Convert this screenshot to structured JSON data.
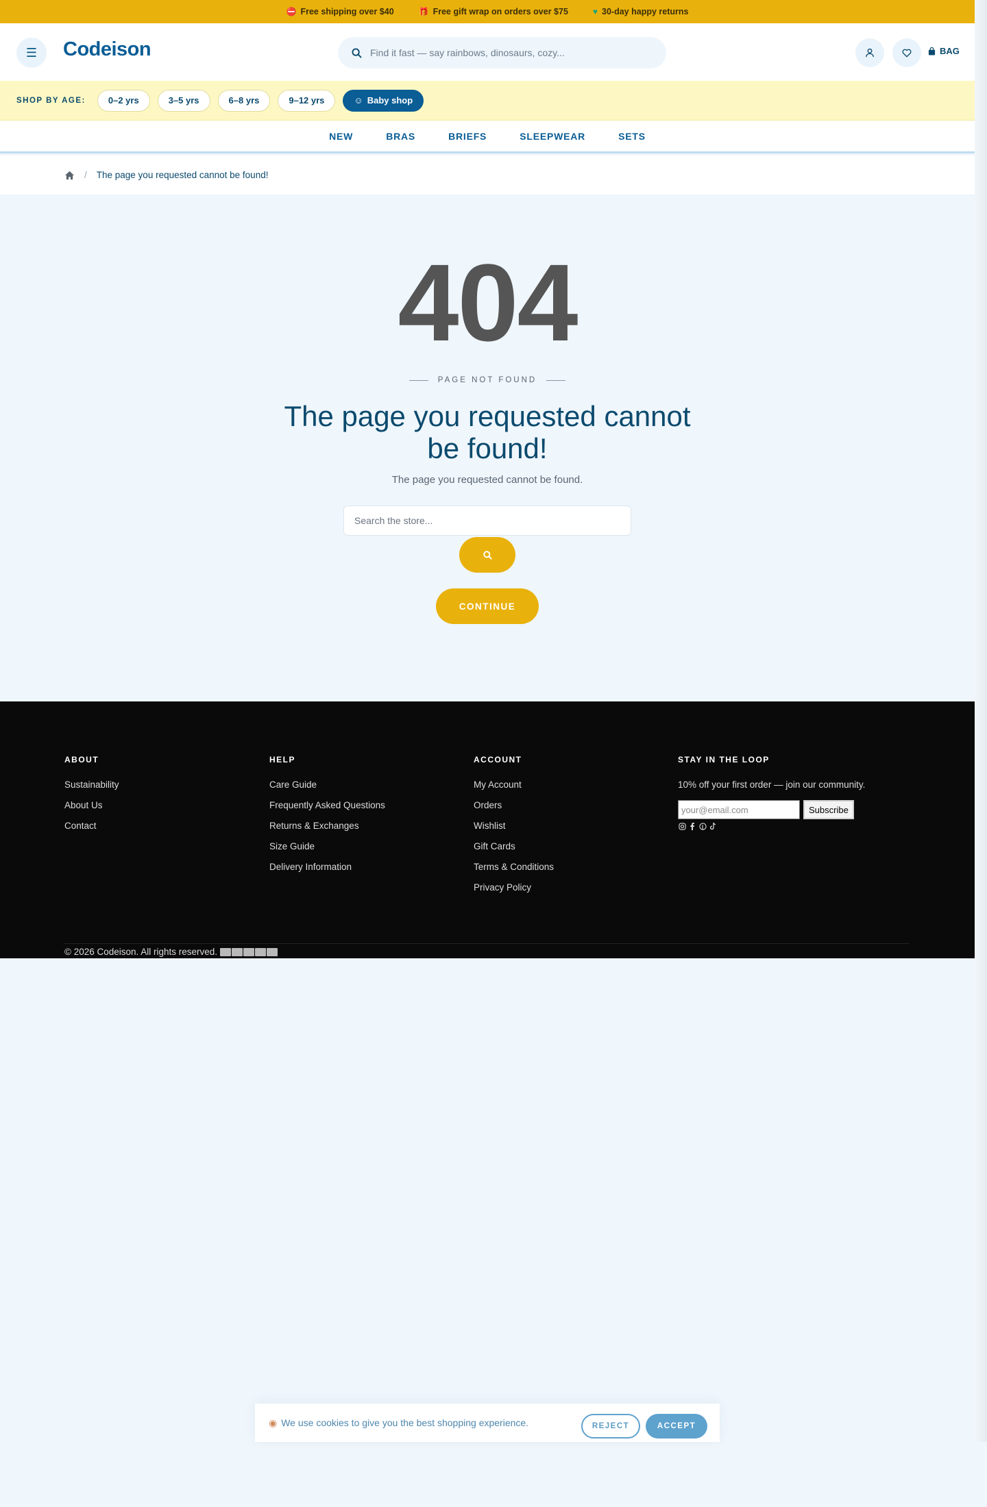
{
  "announcement": {
    "items": [
      {
        "icon": "truck-icon",
        "text": "Free shipping over $40"
      },
      {
        "icon": "gift-icon",
        "text": "Free gift wrap on orders over $75"
      },
      {
        "icon": "heart-icon",
        "text": "30-day happy returns"
      }
    ]
  },
  "header": {
    "logo": "Codeison",
    "search_placeholder": "Find it fast — say rainbows, dinosaurs, cozy...",
    "bag_label": "BAG"
  },
  "agebar": {
    "label": "SHOP BY AGE:",
    "chips": [
      "0–2 yrs",
      "3–5 yrs",
      "6–8 yrs",
      "9–12 yrs"
    ],
    "baby_shop": "Baby shop"
  },
  "nav": {
    "items": [
      "NEW",
      "BRAS",
      "BRIEFS",
      "SLEEPWEAR",
      "SETS"
    ]
  },
  "breadcrumb": {
    "current": "The page you requested cannot be found!"
  },
  "error": {
    "code": "404",
    "eyebrow": "PAGE NOT FOUND",
    "headline": "The page you requested cannot be found!",
    "subtext": "The page you requested cannot be found.",
    "search_placeholder": "Search the store...",
    "continue_label": "CONTINUE"
  },
  "footer": {
    "columns": [
      {
        "title": "ABOUT",
        "links": [
          "Sustainability",
          "About Us",
          "Contact"
        ]
      },
      {
        "title": "HELP",
        "links": [
          "Care Guide",
          "Frequently Asked Questions",
          "Returns & Exchanges",
          "Size Guide",
          "Delivery Information"
        ]
      },
      {
        "title": "ACCOUNT",
        "links": [
          "My Account",
          "Orders",
          "Wishlist",
          "Gift Cards",
          "Terms & Conditions",
          "Privacy Policy"
        ]
      }
    ],
    "newsletter": {
      "title": "STAY IN THE LOOP",
      "text": "10% off your first order — join our community.",
      "placeholder": "your@email.com",
      "button": "Subscribe"
    },
    "copyright": "© 2026 Codeison. All rights reserved."
  },
  "cookie": {
    "text": "We use cookies to give you the best shopping experience.",
    "reject": "REJECT",
    "accept": "ACCEPT"
  },
  "colors": {
    "brand_blue": "#0a5d95",
    "accent_yellow": "#e9b10c",
    "age_bar_bg": "#fdf8c3",
    "footer_bg": "#0a0a0a"
  }
}
